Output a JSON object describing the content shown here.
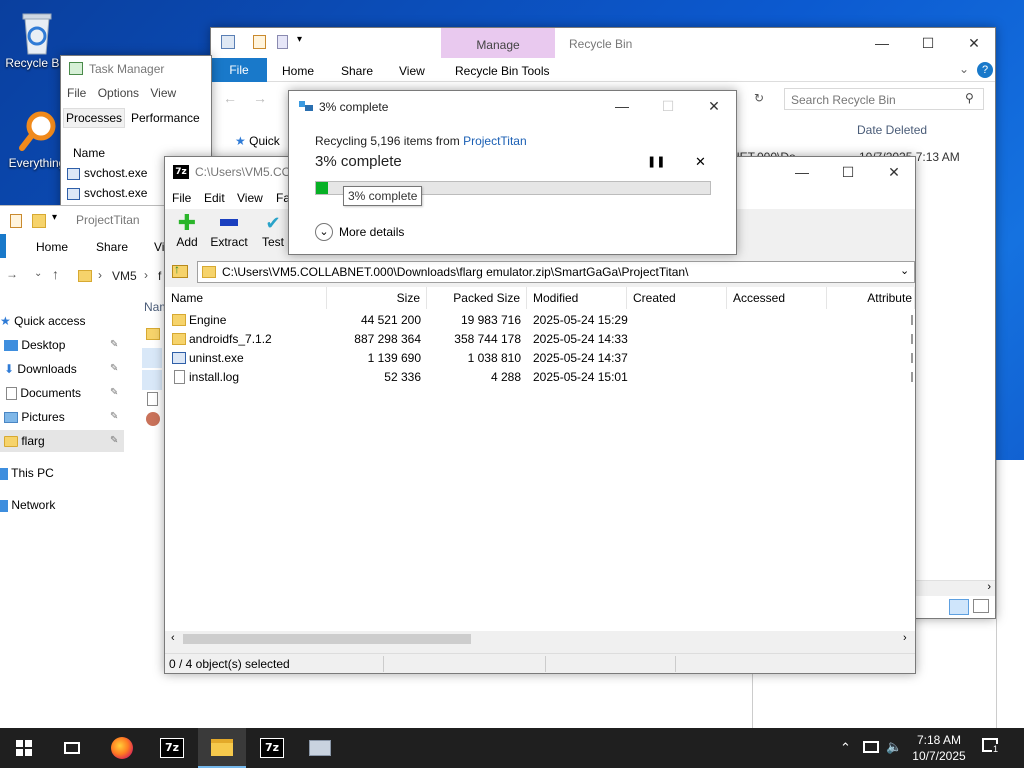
{
  "desktop": {
    "icons": [
      {
        "label": "Recycle Bin",
        "icon": "recycle-bin-icon"
      },
      {
        "label": "Everything",
        "icon": "everything-search-icon"
      }
    ]
  },
  "task_manager": {
    "title": "Task Manager",
    "menu": [
      "File",
      "Options",
      "View"
    ],
    "tabs": [
      "Processes",
      "Performance"
    ],
    "column": "Name",
    "processes": [
      "svchost.exe",
      "svchost.exe"
    ]
  },
  "recycle_bin": {
    "title": "Recycle Bin",
    "context_tab": "Manage",
    "ribbon_tabs": [
      "File",
      "Home",
      "Share",
      "View",
      "Recycle Bin Tools"
    ],
    "search_placeholder": "Search Recycle Bin",
    "quick_access": "Quick",
    "col_date_deleted": "Date Deleted",
    "row_path_fragment": "NET.000\\Do...",
    "row_date": "10/7/2025 7:13 AM"
  },
  "explorer_bg": {
    "title": "ProjectTitan",
    "ribbon_tabs": [
      "Home",
      "Share",
      "Vi"
    ],
    "path": [
      "VM5",
      "f"
    ],
    "col_name": "Nam",
    "nav": [
      {
        "label": "Quick access",
        "icon": "star-icon",
        "pin": false
      },
      {
        "label": "Desktop",
        "icon": "desktop-icon",
        "pin": true
      },
      {
        "label": "Downloads",
        "icon": "download-icon",
        "pin": true
      },
      {
        "label": "Documents",
        "icon": "documents-icon",
        "pin": true
      },
      {
        "label": "Pictures",
        "icon": "pictures-icon",
        "pin": true
      },
      {
        "label": "flarg",
        "icon": "folder-icon",
        "pin": true
      },
      {
        "label": "This PC",
        "icon": "pc-icon",
        "pin": false
      },
      {
        "label": "Network",
        "icon": "network-icon",
        "pin": false
      }
    ]
  },
  "zip": {
    "title": "C:\\Users\\VM5.COLLABNET.000\\Downloads\\flarg emulator.zip\\SmartGaGa\\ProjectTitan\\",
    "title_short": "C:\\Users\\VM5.COL",
    "app_icon_label": "7z",
    "menu": [
      "File",
      "Edit",
      "View",
      "Fa"
    ],
    "toolbar": [
      {
        "label": "Add",
        "icon": "plus-icon",
        "color": "#2bb52b"
      },
      {
        "label": "Extract",
        "icon": "minus-icon",
        "color": "#1a3fbf"
      },
      {
        "label": "Test",
        "icon": "check-icon",
        "color": "#2aa3c9"
      }
    ],
    "address": "C:\\Users\\VM5.COLLABNET.000\\Downloads\\flarg emulator.zip\\SmartGaGa\\ProjectTitan\\",
    "columns": [
      "Name",
      "Size",
      "Packed Size",
      "Modified",
      "Created",
      "Accessed",
      "Attribute"
    ],
    "files": [
      {
        "name": "Engine",
        "icon": "folder-icon",
        "size": "44 521 200",
        "packed": "19 983 716",
        "modified": "2025-05-24 15:29"
      },
      {
        "name": "androidfs_7.1.2",
        "icon": "folder-icon",
        "size": "887 298 364",
        "packed": "358 744 178",
        "modified": "2025-05-24 14:33"
      },
      {
        "name": "uninst.exe",
        "icon": "exe-icon",
        "size": "1 139 690",
        "packed": "1 038 810",
        "modified": "2025-05-24 14:37"
      },
      {
        "name": "install.log",
        "icon": "text-file-icon",
        "size": "52 336",
        "packed": "4 288",
        "modified": "2025-05-24 15:01"
      }
    ],
    "status": "0 / 4 object(s) selected"
  },
  "progress_dialog": {
    "title": "3% complete",
    "subtitle_prefix": "Recycling 5,196 items from ",
    "source_link": "ProjectTitan",
    "heading": "3% complete",
    "tooltip": "3% complete",
    "progress_fraction": 0.03,
    "more_details": "More details",
    "accent": "#06b025"
  },
  "taskbar": {
    "apps": [
      "start-icon",
      "task-view-icon",
      "firefox-icon",
      "7zip-icon",
      "file-explorer-icon",
      "7zip-icon",
      "network-drive-icon"
    ],
    "seven_zip_label": "7z",
    "time": "7:18 AM",
    "date": "10/7/2025",
    "notification_count": "1"
  }
}
